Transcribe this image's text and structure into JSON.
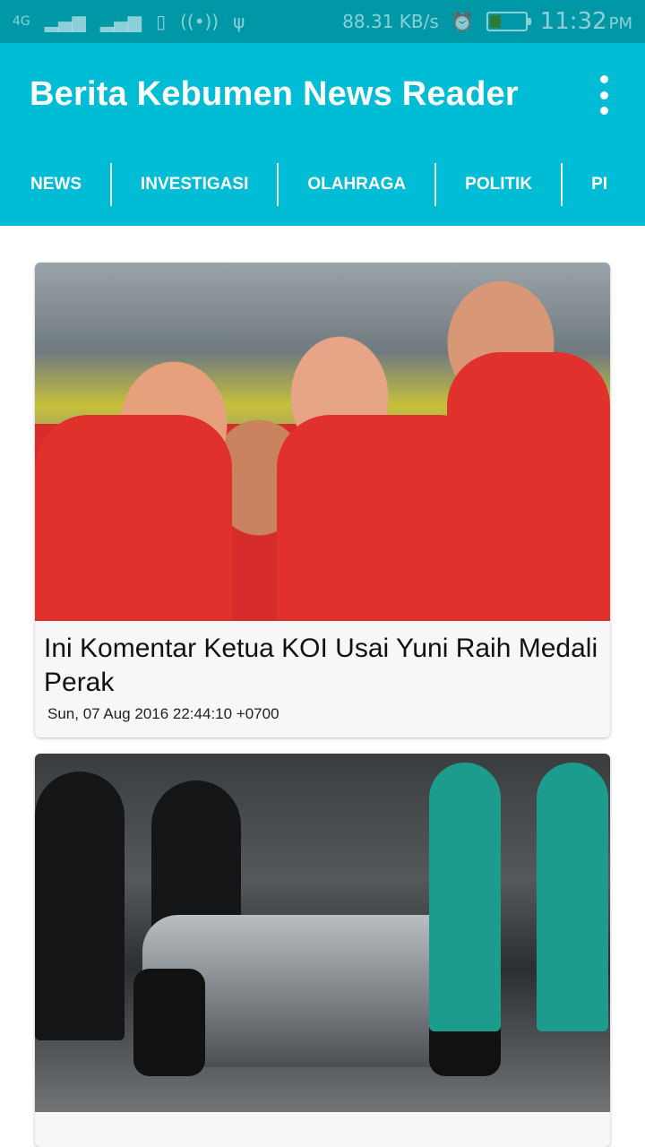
{
  "status_bar": {
    "network_type": "4G",
    "net_speed": "88.31 KB/s",
    "time": "11:32",
    "ampm": "PM",
    "icons": [
      "signal-1-icon",
      "signal-2-icon",
      "vibrate-icon",
      "hotspot-icon",
      "usb-icon",
      "alarm-icon",
      "battery-icon"
    ]
  },
  "app_bar": {
    "title": "Berita Kebumen News Reader",
    "menu_icon": "more-vert-icon",
    "background": "#00bcd4"
  },
  "tabs": [
    {
      "label": "NEWS"
    },
    {
      "label": "INVESTIGASI"
    },
    {
      "label": "OLAHRAGA"
    },
    {
      "label": "POLITIK"
    },
    {
      "label": "PI"
    }
  ],
  "articles": [
    {
      "title": "Ini Komentar Ketua KOI Usai Yuni Raih Medali Perak",
      "date": "Sun, 07 Aug 2016 22:44:10 +0700"
    },
    {
      "title": "",
      "date": ""
    }
  ]
}
